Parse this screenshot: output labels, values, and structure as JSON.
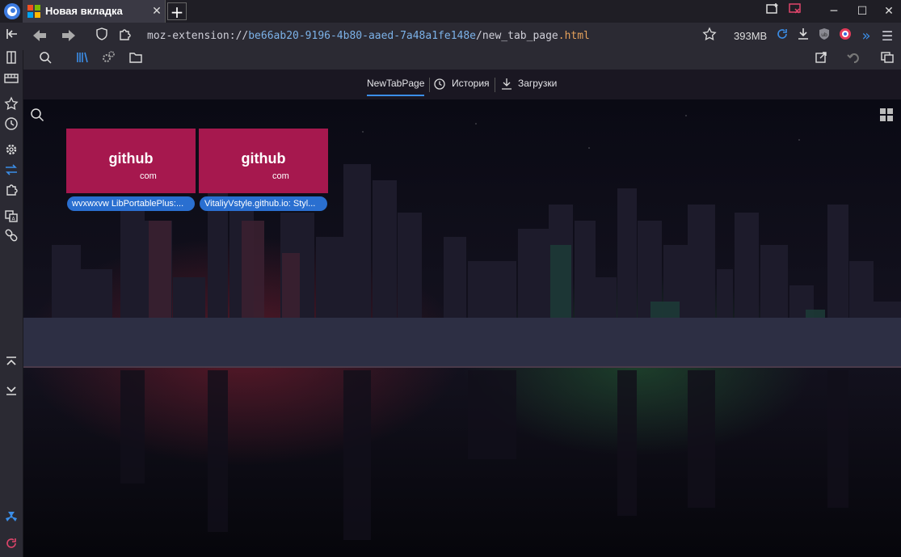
{
  "tab": {
    "title": "Новая вкладка"
  },
  "address_bar": {
    "scheme": "moz-extension://",
    "host": "be66ab20-9196-4b80-aaed-7a48a1fe148e",
    "path": "/new_tab_page",
    "extension": ".html"
  },
  "memory": "393MB",
  "newtab_nav": {
    "items": [
      "NewTabPage",
      "История",
      "Загрузки"
    ],
    "active": "NewTabPage"
  },
  "tiles": [
    {
      "name": "github",
      "tld": "com",
      "label": "wvxwxvw LibPortablePlus:..."
    },
    {
      "name": "github",
      "tld": "com",
      "label": "VitaliyVstyle.github.io: Styl..."
    }
  ],
  "colors": {
    "accent": "#3b8ee8",
    "tile": "#a6184e",
    "label_bg": "#2a6fd0"
  }
}
